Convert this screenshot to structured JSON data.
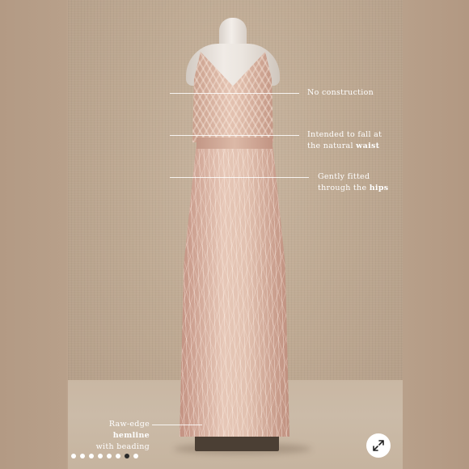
{
  "annotations": [
    {
      "text": "No construction"
    },
    {
      "line1": "Intended to fall at",
      "line2_prefix": "the natural ",
      "line2_bold": "waist"
    },
    {
      "line1": "Gently fitted",
      "line2_prefix": "through the ",
      "line2_bold": "hips"
    },
    {
      "line1_prefix": "Raw-edge ",
      "line1_bold": "hemline",
      "line2": "with beading"
    }
  ],
  "carousel": {
    "total": 8,
    "active_index": 6
  },
  "icons": {
    "expand": "expand-arrows-icon"
  }
}
